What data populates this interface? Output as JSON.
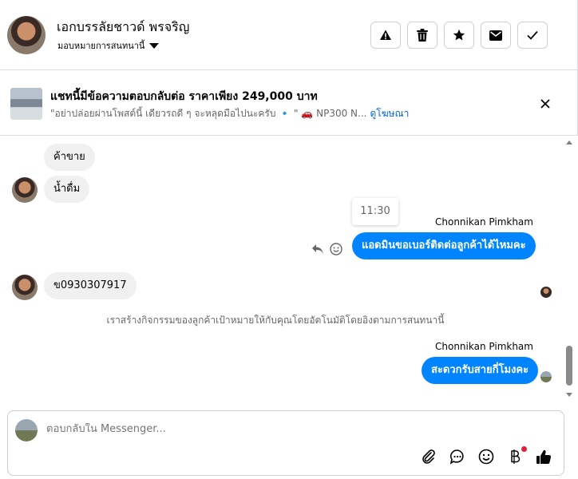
{
  "header": {
    "name": "เอกบรรลัยชาวด์ พรจริญ",
    "assign_label": "มอบหมายการสนทนานี้",
    "actions": [
      "warning-icon",
      "trash-icon",
      "star-icon",
      "mail-icon",
      "check-icon"
    ]
  },
  "ad": {
    "title": "แชทนี้มีข้อความตอบกลับต่อ ราคาเพียง 249,000 บาท",
    "description": "\"อย่าปล่อยผ่านโพสต์นี้ เดียวรถดี ๆ จะหลุดมือไปนะครับ 🔹 \" 🚗 NP300 N...",
    "link": "ดูโฆษณา"
  },
  "chat": {
    "messages_in_1": [
      "ค้าขาย",
      "น้ำดื่ม"
    ],
    "time": "11:30",
    "sender_1": "Chonnikan Pimkham",
    "out_1": "แอดมินขอเบอร์ติดต่อลูกค้าได้ไหมคะ",
    "in_2": "ข0930307917",
    "system": "เราสร้างกิจกรรมของลูกค้าเป้าหมายให้กับคุณโดยอัตโนมัติโดยอิงตามการสนทนานี้",
    "sender_2": "Chonnikan Pimkham",
    "out_2": "สะดวกรับสายกี่โมงคะ"
  },
  "composer": {
    "placeholder": "ตอบกลับใน Messenger..."
  }
}
